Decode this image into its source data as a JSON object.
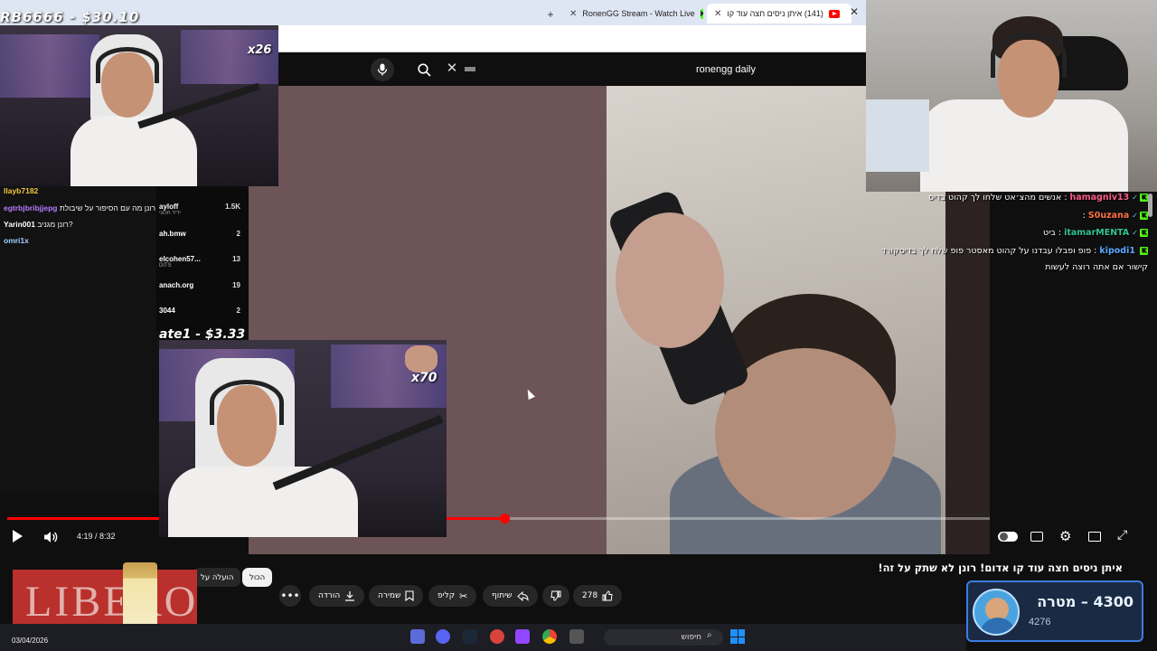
{
  "browser": {
    "tabs": [
      {
        "label": "RonenGG Stream - Watch Live"
      },
      {
        "label": "(141) איתן ניסים חצה עוד קו"
      }
    ]
  },
  "youtube": {
    "search": {
      "value": "ronengg daily"
    },
    "player": {
      "time": "4:19 / 8:32",
      "progress_fraction": 0.5058
    },
    "video_title": "איתן ניסים חצה עוד קו אדום! רונן לא שתק על זה!",
    "actions": {
      "like_count": "278",
      "share_label": "שיתוף",
      "clip_label": "קליפ",
      "save_label": "שמירה",
      "download_label": "הורדה"
    },
    "chips": {
      "all": "הכול",
      "uploaded": "הועלה על"
    }
  },
  "stream_overlay": {
    "top_donation": "RB6666 - $30.10",
    "cam_top_multiplier": "x26",
    "cam_mid_multiplier": "x70",
    "mid_donation": "ate1 - $3.33"
  },
  "left_chat": [
    {
      "user": "llayb7182",
      "color": "#f5c542",
      "message": ""
    },
    {
      "user": "egtrbjbribjjepg",
      "color": "#b57cff",
      "message": "רונן מה עם הסיפור על שיבולת"
    },
    {
      "user": "Yarin001",
      "color": "#ffffff",
      "message": "רונן מגניב?"
    },
    {
      "user": "omri1x",
      "color": "#9fd0ff",
      "message": ""
    }
  ],
  "viewer_list": [
    {
      "name": "ayloff",
      "sub": "ידיד חלוני",
      "count": "1.5K"
    },
    {
      "name": "ah.bmw",
      "sub": "",
      "count": "2"
    },
    {
      "name": "elcohen57...",
      "sub": "DITS",
      "count": "13"
    },
    {
      "name": "anach.org",
      "sub": "",
      "count": "19"
    },
    {
      "name": "3044",
      "sub": "",
      "count": "2"
    }
  ],
  "right_chat": [
    {
      "user": "hamagniv13",
      "color": "#ff5c8a",
      "message": "אנשים מהצ׳אט שלחו לך קהוט בדיס"
    },
    {
      "user": "S0uzana",
      "color": "#ff7043",
      "message": ""
    },
    {
      "user": "itamarMENTA",
      "color": "#32c48d",
      "message": "ביט"
    },
    {
      "user": "kipodi1",
      "color": "#5aa9ff",
      "message": "פופ ופבלו עבדנו על קהוט מאסטר פופ שלח לך בדיסקורד"
    },
    {
      "user": "",
      "color": "#ffffff",
      "message": "קישור אם אתה רוצה לעשות"
    }
  ],
  "goal_widget": {
    "title": "4300 – מטרה",
    "current": "4276"
  },
  "ad": {
    "text": "LIBERO"
  },
  "taskbar": {
    "date": "03/04/2026",
    "search_label": "חיפוש"
  },
  "colors": {
    "accent": "#ff0000",
    "kick": "#53fc18",
    "goal_bg": "#1b2a44"
  }
}
